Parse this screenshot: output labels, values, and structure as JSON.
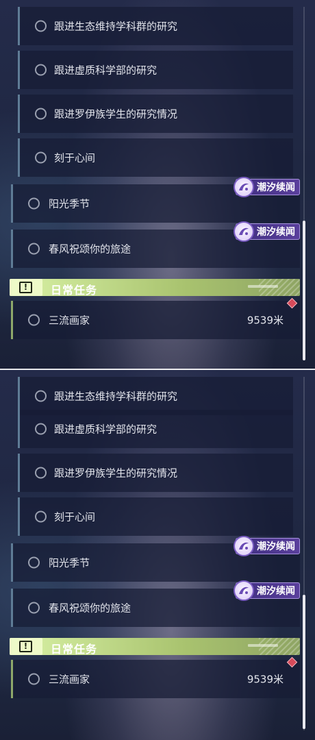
{
  "quests": {
    "sub1": "跟进生态维持学科群的研究",
    "sub2": "跟进虚质科学部的研究",
    "sub3": "跟进罗伊族学生的研究情况",
    "sub4": "刻于心间",
    "main1": "阳光季节",
    "main2": "春风祝颂你的旅途"
  },
  "tag_label": "潮汐续闻",
  "daily": {
    "header": "日常任务",
    "icon_symbol": "!",
    "item_label": "三流画家",
    "distance": "9539米"
  },
  "colors": {
    "daily_accent": "#a9c36f",
    "tag_purple": "#5a3f9c",
    "marker_red": "#d64a5a"
  },
  "icons": [
    "radio-circle-icon",
    "tide-badge-icon",
    "daily-quest-icon",
    "diamond-marker-icon"
  ]
}
